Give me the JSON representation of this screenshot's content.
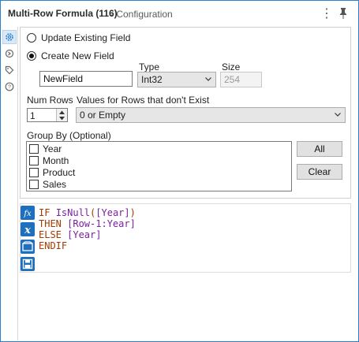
{
  "window": {
    "title": "Multi-Row Formula (116)",
    "subtitle": " - Configuration"
  },
  "options": {
    "update_existing_label": "Update Existing Field",
    "create_new_label": "Create New  Field",
    "selected": "create_new"
  },
  "new_field": {
    "name_value": "NewField",
    "type_header": "Type",
    "type_value": "Int32",
    "size_header": "Size",
    "size_value": "254"
  },
  "rows": {
    "num_rows_label": "Num Rows",
    "num_rows_value": "1",
    "missing_rows_label": "Values for Rows that don't Exist",
    "missing_rows_value": "0 or Empty"
  },
  "group_by": {
    "label": "Group By (Optional)",
    "items": [
      {
        "label": "Year",
        "checked": false
      },
      {
        "label": "Month",
        "checked": false
      },
      {
        "label": "Product",
        "checked": false
      },
      {
        "label": "Sales",
        "checked": false
      }
    ],
    "all_button": "All",
    "clear_button": "Clear"
  },
  "expression": {
    "line1_kw": "IF ",
    "line1_fn": "IsNull",
    "line1_open": "(",
    "line1_field": "[Year]",
    "line1_close": ")",
    "line2_kw": "THEN ",
    "line2_field": "[Row-1:Year]",
    "line3_kw": "ELSE ",
    "line3_field": "[Year]",
    "line4_kw": "ENDIF"
  },
  "colors": {
    "accent": "#2b7fd1",
    "keyword": "#a03c00",
    "function": "#7b1fa2",
    "field": "#7b1fa2"
  },
  "icons": {
    "sidebar": [
      "gear-icon",
      "circle-arrow-icon",
      "tag-icon",
      "help-icon"
    ],
    "editor_tools": [
      "fx-icon",
      "variable-x-icon",
      "saved-expressions-icon",
      "save-icon"
    ]
  }
}
